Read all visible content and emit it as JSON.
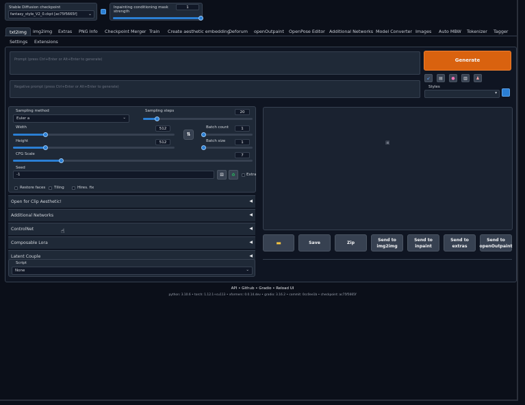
{
  "top": {
    "checkpoint_label": "Stable Diffusion checkpoint",
    "checkpoint_value": "fantasy_style_V2_0.ckpt [ac75f5665f]",
    "mask_strength_label": "Inpainting conditioning mask strength",
    "mask_strength_value": "1",
    "mask_strength_level": 1.0
  },
  "tabs": [
    "txt2img",
    "img2img",
    "Extras",
    "PNG Info",
    "Checkpoint Merger",
    "Train",
    "Create aesthetic embedding",
    "Deforum",
    "openOutpaint",
    "OpenPose Editor",
    "Additional Networks",
    "Model Converter",
    "Images",
    "Auto MBW",
    "Tokenizer",
    "Tagger"
  ],
  "tabs_row2": [
    "Settings",
    "Extensions"
  ],
  "prompt": {
    "placeholder": "Prompt (press Ctrl+Enter or Alt+Enter to generate)",
    "negative_placeholder": "Negative prompt (press Ctrl+Enter or Alt+Enter to generate)"
  },
  "generate_label": "Generate",
  "styles_label": "Styles",
  "sampling": {
    "method_label": "Sampling method",
    "method_value": "Euler a",
    "steps_label": "Sampling steps",
    "steps_value": "20",
    "steps_level": 0.13
  },
  "width": {
    "label": "Width",
    "value": "512",
    "level": 0.2
  },
  "height": {
    "label": "Height",
    "value": "512",
    "level": 0.2
  },
  "batch_count": {
    "label": "Batch count",
    "value": "1",
    "level": 0.0
  },
  "batch_size": {
    "label": "Batch size",
    "value": "1",
    "level": 0.0
  },
  "cfg": {
    "label": "CFG Scale",
    "value": "7",
    "level": 0.2
  },
  "swap_icon_text": "⇅",
  "seed": {
    "label": "Seed",
    "value": "-1",
    "extra_label": "Extra"
  },
  "options": {
    "restore_faces": "Restore faces",
    "tiling": "Tiling",
    "hires": "Hires. fix"
  },
  "accordions": [
    "Open for Clip Aesthetic!",
    "Additional Networks",
    "ControlNet",
    "Composable Lora",
    "Latent Couple"
  ],
  "script": {
    "label": "Script",
    "value": "None"
  },
  "actions": {
    "folder_icon": "folder-icon",
    "save": "Save",
    "zip": "Zip",
    "send_img2img": "Send to img2img",
    "send_inpaint": "Send to inpaint",
    "send_extras": "Send to extras",
    "send_outpaint": "Send to openOutpaint"
  },
  "footer": {
    "links": [
      "API",
      "Github",
      "Gradio",
      "Reload UI"
    ],
    "versions": "python: 3.10.6  •  torch: 1.12.1+cu113  •  xformers: 0.0.14.dev  •  gradio: 3.16.2  •  commit: 0cc0ee1b  •  checkpoint: ac75f5665f"
  },
  "colors": {
    "accent": "#2b7fd4",
    "generate": "#e0600e",
    "bg": "#0b0f19",
    "panel": "#1f2937"
  }
}
